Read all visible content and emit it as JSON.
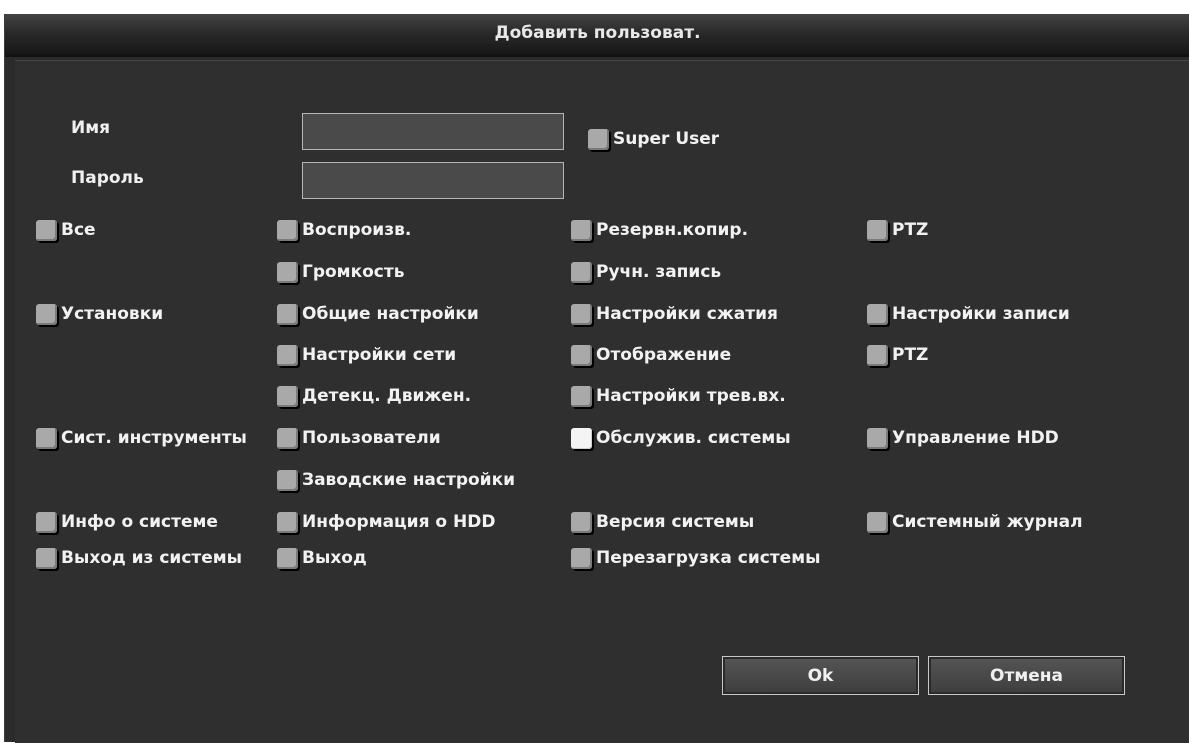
{
  "dialog": {
    "title": "Добавить пользоват.",
    "name_label": "Имя",
    "password_label": "Пароль",
    "name_value": "",
    "password_value": "",
    "super_user_label": "Super User",
    "super_user_checked": false
  },
  "permissions": {
    "all": {
      "label": "Все",
      "checked": false
    },
    "playback": {
      "label": "Воспроизв.",
      "checked": false
    },
    "backup": {
      "label": "Резервн.копир.",
      "checked": false
    },
    "ptz_top": {
      "label": "PTZ",
      "checked": false
    },
    "volume": {
      "label": "Громкость",
      "checked": false
    },
    "manual_record": {
      "label": "Ручн. запись",
      "checked": false
    },
    "settings": {
      "label": "Установки",
      "checked": false
    },
    "general_settings": {
      "label": "Общие настройки",
      "checked": false
    },
    "compression_settings": {
      "label": "Настройки сжатия",
      "checked": false
    },
    "record_settings": {
      "label": "Настройки записи",
      "checked": false
    },
    "network_settings": {
      "label": "Настройки сети",
      "checked": false
    },
    "display": {
      "label": "Отображение",
      "checked": false
    },
    "ptz_settings": {
      "label": "PTZ",
      "checked": false
    },
    "motion_detect": {
      "label": "Детекц. Движен.",
      "checked": false
    },
    "alarm_input_settings": {
      "label": "Настройки трев.вх.",
      "checked": false
    },
    "system_tools": {
      "label": "Сист. инструменты",
      "checked": false
    },
    "users": {
      "label": "Пользователи",
      "checked": false
    },
    "system_maintenance": {
      "label": "Обслужив. системы",
      "checked": true
    },
    "hdd_management": {
      "label": "Управление HDD",
      "checked": false
    },
    "factory_settings": {
      "label": "Заводские настройки",
      "checked": false
    },
    "system_info": {
      "label": "Инфо о системе",
      "checked": false
    },
    "hdd_info": {
      "label": "Информация о HDD",
      "checked": false
    },
    "system_version": {
      "label": "Версия системы",
      "checked": false
    },
    "system_log": {
      "label": "Системный журнал",
      "checked": false
    },
    "logout_group": {
      "label": "Выход из системы",
      "checked": false
    },
    "logout": {
      "label": "Выход",
      "checked": false
    },
    "reboot": {
      "label": "Перезагрузка системы",
      "checked": false
    }
  },
  "buttons": {
    "ok": "Ok",
    "cancel": "Отмена"
  }
}
